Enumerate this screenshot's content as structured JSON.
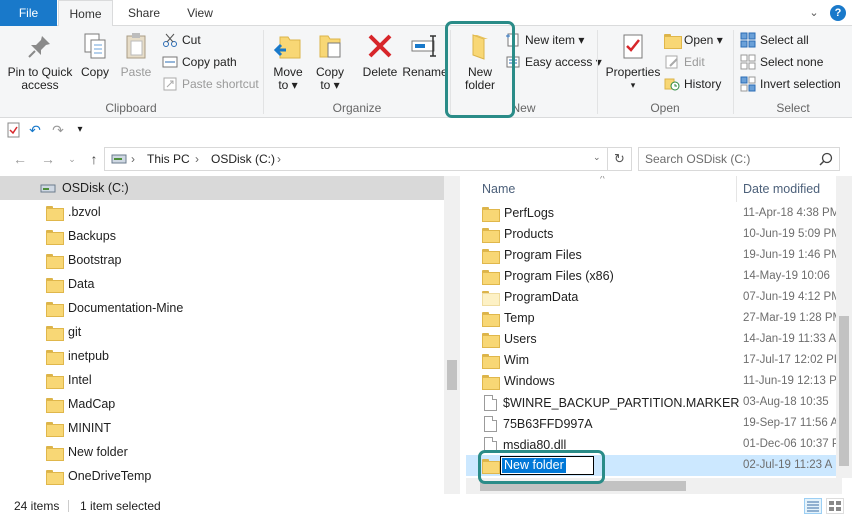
{
  "tabs": {
    "file": "File",
    "home": "Home",
    "share": "Share",
    "view": "View"
  },
  "ribbon": {
    "clipboard": {
      "label": "Clipboard",
      "pin_line1": "Pin to Quick",
      "pin_line2": "access",
      "copy": "Copy",
      "paste": "Paste",
      "cut": "Cut",
      "copy_path": "Copy path",
      "paste_shortcut": "Paste shortcut"
    },
    "organize": {
      "label": "Organize",
      "move_to": "Move",
      "move_to2": "to ▾",
      "copy_to": "Copy",
      "copy_to2": "to ▾",
      "delete": "Delete",
      "rename": "Rename"
    },
    "new": {
      "label": "New",
      "new_folder_line1": "New",
      "new_folder_line2": "folder",
      "new_item": "New item ▾",
      "easy_access": "Easy access ▾"
    },
    "open": {
      "label": "Open",
      "properties": "Properties",
      "open": "Open ▾",
      "edit": "Edit",
      "history": "History"
    },
    "select": {
      "label": "Select",
      "select_all": "Select all",
      "select_none": "Select none",
      "invert": "Invert selection"
    }
  },
  "address": {
    "this_pc": "This PC",
    "drive": "OSDisk (C:)"
  },
  "search": {
    "placeholder": "Search OSDisk (C:)"
  },
  "nav": {
    "selected": "OSDisk (C:)",
    "items": [
      ".bzvol",
      "Backups",
      "Bootstrap",
      "Data",
      "Documentation-Mine",
      "git",
      "inetpub",
      "Intel",
      "MadCap",
      "MININT",
      "New folder",
      "OneDriveTemp"
    ]
  },
  "columns": {
    "name": "Name",
    "date": "Date modified"
  },
  "files": [
    {
      "name": "PerfLogs",
      "date": "11-Apr-18 4:38 PM",
      "type": "folder"
    },
    {
      "name": "Products",
      "date": "10-Jun-19 5:09 PM",
      "type": "folder"
    },
    {
      "name": "Program Files",
      "date": "19-Jun-19 1:46 PM",
      "type": "folder"
    },
    {
      "name": "Program Files (x86)",
      "date": "14-May-19 10:06",
      "type": "folder"
    },
    {
      "name": "ProgramData",
      "date": "07-Jun-19 4:12 PM",
      "type": "folder-pale"
    },
    {
      "name": "Temp",
      "date": "27-Mar-19 1:28 PM",
      "type": "folder"
    },
    {
      "name": "Users",
      "date": "14-Jan-19 11:33 A",
      "type": "folder"
    },
    {
      "name": "Wim",
      "date": "17-Jul-17 12:02 PI",
      "type": "folder"
    },
    {
      "name": "Windows",
      "date": "11-Jun-19 12:13 P",
      "type": "folder"
    },
    {
      "name": "$WINRE_BACKUP_PARTITION.MARKER",
      "date": "03-Aug-18 10:35",
      "type": "file"
    },
    {
      "name": "75B63FFD997A",
      "date": "19-Sep-17 11:56 A",
      "type": "file"
    },
    {
      "name": "msdia80.dll",
      "date": "01-Dec-06 10:37 P",
      "type": "file"
    }
  ],
  "renaming": {
    "value": "New folder",
    "date": "02-Jul-19 11:23 A"
  },
  "status": {
    "count": "24 items",
    "selected": "1 item selected"
  }
}
